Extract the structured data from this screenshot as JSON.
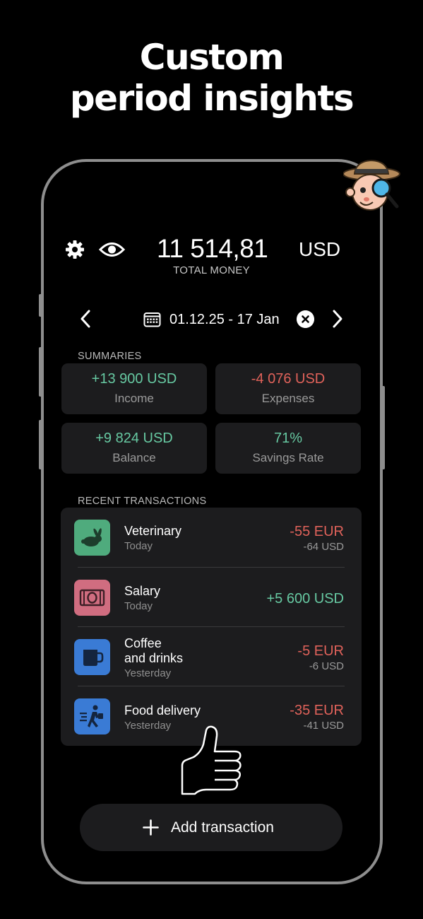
{
  "headline": {
    "line1": "Custom",
    "line2": "period insights"
  },
  "header": {
    "total_amount": "11 514,81",
    "currency": "USD",
    "total_label": "TOTAL MONEY",
    "settings_icon": "gear-icon",
    "visibility_icon": "eye-icon"
  },
  "period": {
    "range": "01.12.25 - 17 Jan",
    "calendar_icon": "calendar-icon",
    "clear_icon": "close-circle-icon"
  },
  "summaries": {
    "title": "SUMMARIES",
    "cards": [
      {
        "value": "+13 900 USD",
        "label": "Income",
        "color": "#67c9a2"
      },
      {
        "value": "-4 076 USD",
        "label": "Expenses",
        "color": "#e0625a"
      },
      {
        "value": "+9 824 USD",
        "label": "Balance",
        "color": "#67c9a2"
      },
      {
        "value": "71%",
        "label": "Savings Rate",
        "color": "#67c9a2"
      }
    ]
  },
  "recent": {
    "title": "RECENT TRANSACTIONS",
    "items": [
      {
        "title": "Veterinary",
        "subtitle": "Today",
        "amount": "-55 EUR",
        "converted": "-64 USD",
        "icon": "rabbit-icon",
        "icon_color": "#4fab7d",
        "amount_color": "#e0625a"
      },
      {
        "title": "Salary",
        "subtitle": "Today",
        "amount": "+5 600 USD",
        "converted": "",
        "icon": "banknote-icon",
        "icon_color": "#d06d80",
        "amount_color": "#67c9a2"
      },
      {
        "title": "Coffee",
        "title2": "and drinks",
        "subtitle": "Yesterday",
        "amount": "-5 EUR",
        "converted": "-6 USD",
        "icon": "cup-icon",
        "icon_color": "#3a7bd5",
        "amount_color": "#e0625a"
      },
      {
        "title": "Food delivery",
        "subtitle": "Yesterday",
        "amount": "-35 EUR",
        "converted": "-41 USD",
        "icon": "courier-icon",
        "icon_color": "#3a7bd5",
        "amount_color": "#e0625a"
      }
    ]
  },
  "add_button": {
    "label": "Add transaction",
    "icon": "plus-icon"
  },
  "colors": {
    "positive": "#67c9a2",
    "negative": "#e0625a",
    "card_bg": "#1c1c1e",
    "frame": "#8e8e8e"
  }
}
